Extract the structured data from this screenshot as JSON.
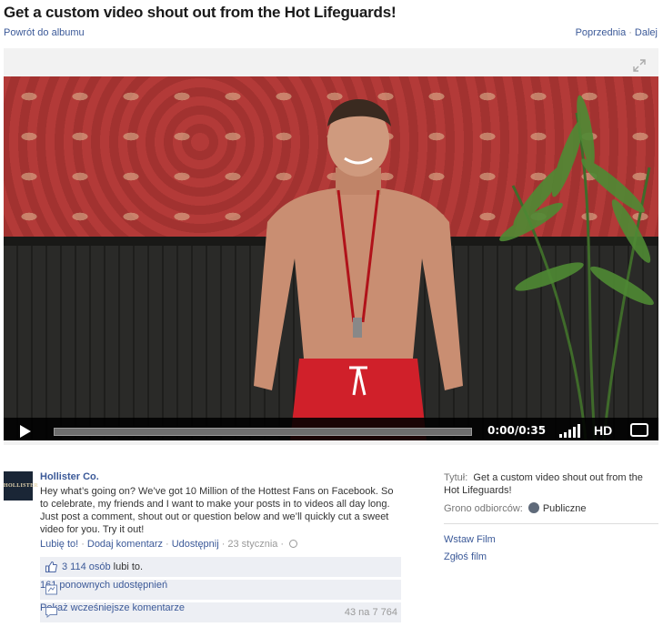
{
  "header": {
    "title": "Get a custom video shout out from the Hot Lifeguards!",
    "back_label": "Powrót do albumu",
    "prev_label": "Poprzednia",
    "separator": "·",
    "next_label": "Dalej"
  },
  "player": {
    "time": "0:00/0:35",
    "hd_label": "HD",
    "progress": 0
  },
  "post": {
    "avatar_text": "HOLLISTER",
    "owner": "Hollister Co.",
    "description": "Hey what’s going on? We’ve got 10 Million of the Hottest Fans on Facebook. So to celebrate, my friends and I want to make your posts in to videos all day long. Just post a comment, shout out or question below and we’ll quickly cut a sweet video for you. Try it out!",
    "like_label": "Lubię to!",
    "comment_label": "Dodaj komentarz",
    "share_label": "Udostępnij",
    "date": "23 stycznia",
    "sep": "·"
  },
  "ufi": {
    "likes_count": "3 114 osób",
    "likes_suffix": " lubi to.",
    "shares": "161 ponownych udostępnień",
    "more_comments": "Pokaż wcześniejsze komentarze",
    "comments_count": "43 na 7 764"
  },
  "sidebar": {
    "title_label": "Tytuł:",
    "title_value": "Get a custom video shout out from the Hot Lifeguards!",
    "audience_label": "Grono odbiorców:",
    "audience_value": "Publiczne",
    "embed_label": "Wstaw Film",
    "report_label": "Zgłoś film"
  },
  "colors": {
    "link": "#3b5998",
    "ufi_background": "#edeff4",
    "player_bar": "#000000"
  }
}
